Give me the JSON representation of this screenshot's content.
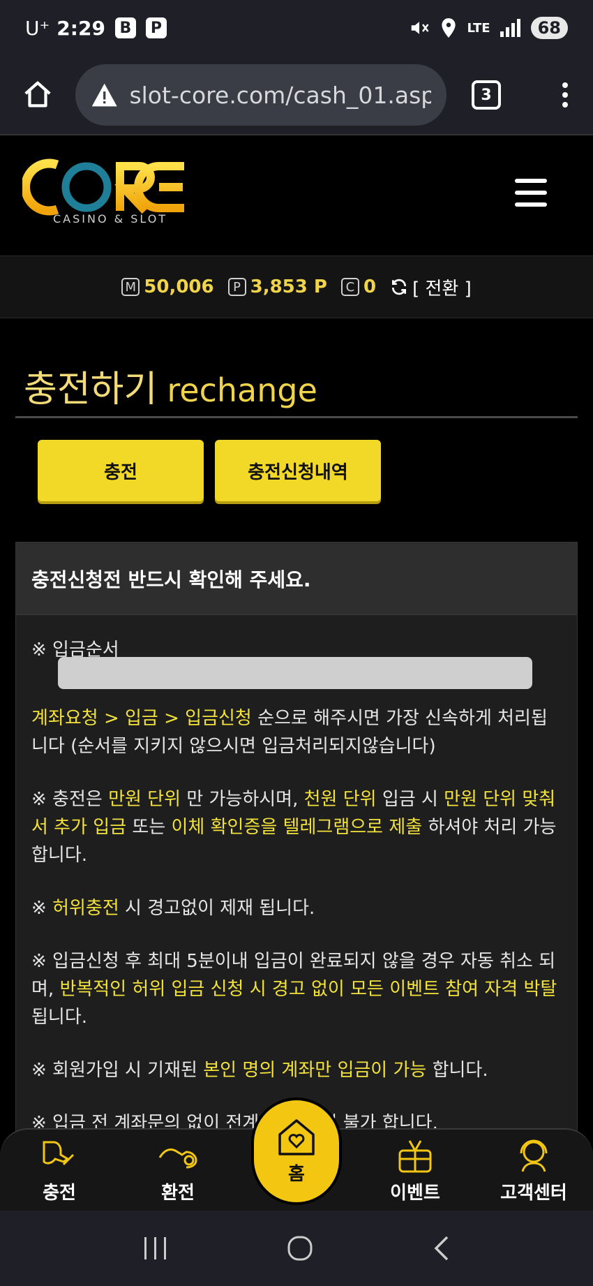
{
  "status_bar": {
    "carrier": "U⁺",
    "time": "2:29",
    "badge_b": "B",
    "badge_p": "P",
    "network": "LTE",
    "battery": "68",
    "icons": [
      "mute-icon",
      "location-icon",
      "signal-icon"
    ]
  },
  "browser": {
    "url": "slot-core.com/cash_01.asp",
    "tab_count": "3",
    "icons": [
      "home-icon",
      "warning-icon",
      "more-icon"
    ]
  },
  "header": {
    "logo_text": "CORE",
    "logo_sub": "CASINO & SLOT",
    "logo_colors": {
      "gold": "#f3c612",
      "teal": "#1f7f99"
    }
  },
  "money": {
    "m_label": "M",
    "m_value": "50,006",
    "p_label": "P",
    "p_value": "3,853 P",
    "c_label": "C",
    "c_value": "0",
    "convert_label": "[ 전환 ]"
  },
  "page": {
    "title_ko": "충전하기",
    "title_en": "rechange"
  },
  "tabs": [
    {
      "label": "충전"
    },
    {
      "label": "충전신청내역"
    }
  ],
  "notice": {
    "heading": "충전신청전 반드시 확인해 주세요.",
    "order_label": "※ 입금순서",
    "p1_hl": "계좌요청 > 입금 > 입금신청",
    "p1_rest": " 순으로 해주시면 가장 신속하게 처리됩니다 (순서를 지키지 않으시면 입금처리되지않습니다)",
    "p2_a": "※ 충전은 ",
    "p2_hl1": "만원 단위",
    "p2_b": " 만 가능하시며, ",
    "p2_hl2": "천원 단위",
    "p2_c": " 입금 시 ",
    "p2_hl3": "만원 단위 맞춰서 추가 입금",
    "p2_d": " 또는 ",
    "p2_hl4": "이체 확인증을 텔레그램으로 제출",
    "p2_e": " 하셔야 처리 가능합니다.",
    "p3_a": "※ ",
    "p3_hl": "허위충전",
    "p3_b": " 시 경고없이 제재 됩니다.",
    "p4_a": "※ 입금신청 후 최대 5분이내 입금이 완료되지 않을 경우 자동 취소 되며, ",
    "p4_hl": "반복적인 허위 입금 신청 시 경고 없이 모든 이벤트 참여 자격 박탈",
    "p4_b": "됩니다.",
    "p5_a": "※ 회원가입 시 기재된 ",
    "p5_hl": "본인 명의 계좌만 입금이 가능",
    "p5_b": " 합니다.",
    "p6": "※ 입금 전 계좌문의 없이 전계좌  시 처리 불가 합니다."
  },
  "bottom_nav": {
    "charge": "충전",
    "exchange": "환전",
    "home": "홈",
    "event": "이벤트",
    "support": "고객센터"
  }
}
